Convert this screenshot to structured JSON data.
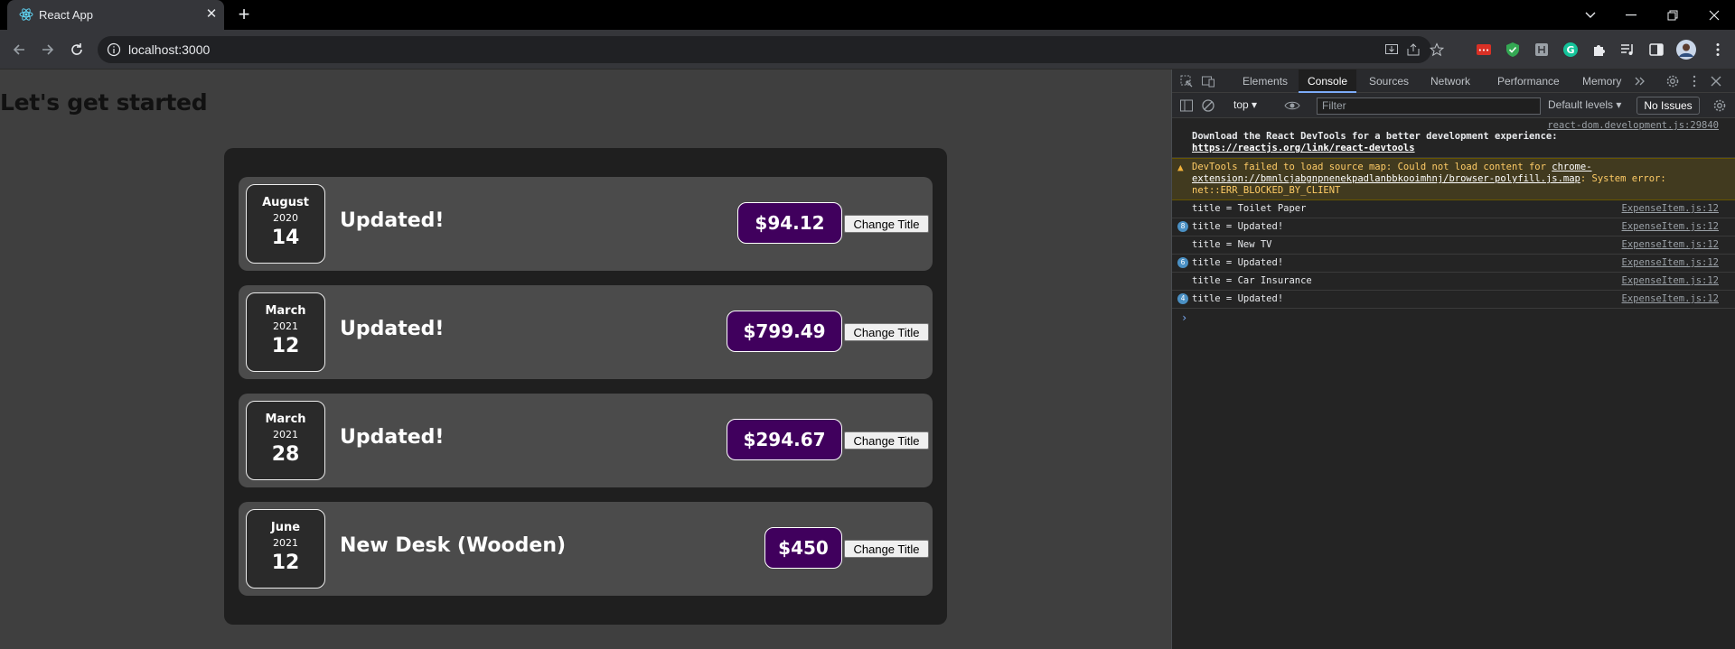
{
  "browser": {
    "tab_title": "React App",
    "tab_close": "✕",
    "new_tab": "+",
    "url": "localhost:3000"
  },
  "page": {
    "heading": "Let's get started",
    "change_title_label": "Change Title",
    "expenses": [
      {
        "month": "August",
        "year": "2020",
        "day": "14",
        "title": "Updated!",
        "amount": "$94.12"
      },
      {
        "month": "March",
        "year": "2021",
        "day": "12",
        "title": "Updated!",
        "amount": "$799.49"
      },
      {
        "month": "March",
        "year": "2021",
        "day": "28",
        "title": "Updated!",
        "amount": "$294.67"
      },
      {
        "month": "June",
        "year": "2021",
        "day": "12",
        "title": "New Desk (Wooden)",
        "amount": "$450"
      }
    ]
  },
  "devtools": {
    "tabs": [
      "Elements",
      "Console",
      "Sources",
      "Network",
      "Performance",
      "Memory"
    ],
    "active_tab": "Console",
    "context": "top",
    "filter_placeholder": "Filter",
    "levels": "Default levels",
    "issues": "No Issues",
    "messages": {
      "devtools_source": "react-dom.development.js:29840",
      "devtools_text": "Download the React DevTools for a better development experience: ",
      "devtools_link": "https://reactjs.org/link/react-devtools",
      "warn_text1": "DevTools failed to load source map: Could not load content for ",
      "warn_link": "chrome-extension://bmnlcjabgnpnenekpadlanbbkooimhnj/browser-polyfill.js.map",
      "warn_text2": ": System error: net::ERR_BLOCKED_BY_CLIENT",
      "logs": [
        {
          "badge": "",
          "text": "title = Toilet Paper",
          "src": "ExpenseItem.js:12"
        },
        {
          "badge": "8",
          "text": "title = Updated!",
          "src": "ExpenseItem.js:12"
        },
        {
          "badge": "",
          "text": "title = New TV",
          "src": "ExpenseItem.js:12"
        },
        {
          "badge": "6",
          "text": "title = Updated!",
          "src": "ExpenseItem.js:12"
        },
        {
          "badge": "",
          "text": "title = Car Insurance",
          "src": "ExpenseItem.js:12"
        },
        {
          "badge": "4",
          "text": "title = Updated!",
          "src": "ExpenseItem.js:12"
        }
      ],
      "prompt": "›"
    }
  },
  "colors": {
    "price_bg": "#40005d",
    "card_bg": "#4b4b4b",
    "container_bg": "#1f1f1f",
    "page_bg": "#3f3f3f"
  }
}
